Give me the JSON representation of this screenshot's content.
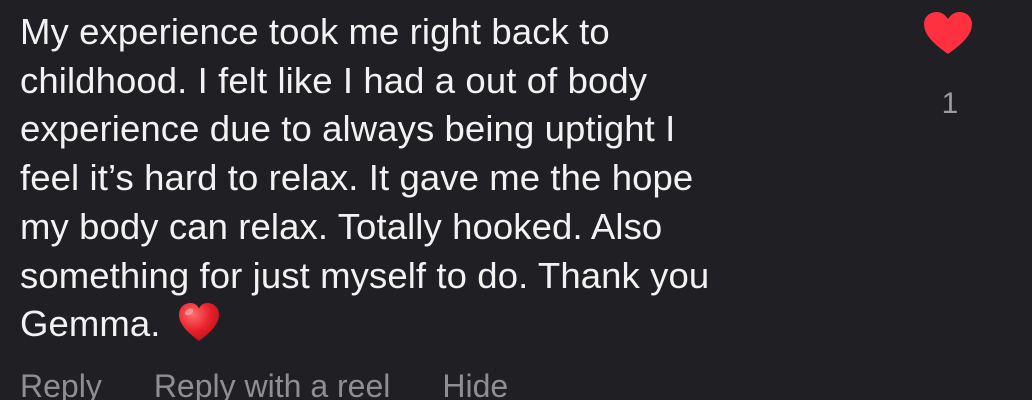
{
  "comment": {
    "lines": [
      "My experience took me right back to",
      "childhood.  I felt like I had a out of body",
      "experience due to always being uptight I",
      "feel it’s hard to relax.  It gave me the hope",
      "my body can relax. Totally hooked. Also",
      "something for just myself to do. Thank you",
      "Gemma."
    ],
    "trailing_emoji": "red-heart-emoji"
  },
  "like": {
    "icon": "heart-icon",
    "color": "#ff3040",
    "liked": true,
    "count": "1"
  },
  "actions": {
    "reply": "Reply",
    "reply_with_reel": "Reply with a reel",
    "hide": "Hide"
  },
  "colors": {
    "background": "#202024",
    "text": "#f2f2f2",
    "muted": "#8e8e93",
    "like_red": "#ff3040"
  }
}
